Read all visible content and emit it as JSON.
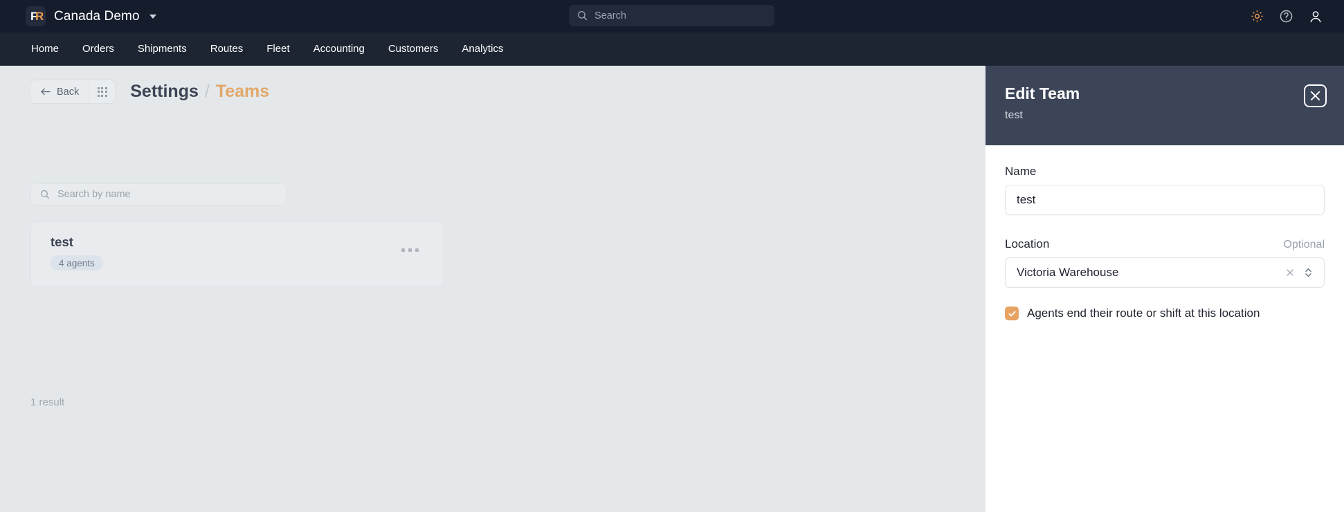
{
  "topbar": {
    "logo_letter_f": "F",
    "logo_letter_r": "R",
    "org_name": "Canada Demo",
    "search_placeholder": "Search",
    "icons": [
      "gear-icon",
      "help-icon",
      "account-icon"
    ],
    "bg_color": "#151c2c",
    "accent_color": "#e89a4f"
  },
  "nav": {
    "items": [
      {
        "label": "Home"
      },
      {
        "label": "Orders"
      },
      {
        "label": "Shipments"
      },
      {
        "label": "Routes"
      },
      {
        "label": "Fleet"
      },
      {
        "label": "Accounting"
      },
      {
        "label": "Customers"
      },
      {
        "label": "Analytics"
      }
    ],
    "bg_color": "#1d2533"
  },
  "toolbar": {
    "back_label": "Back",
    "grid_icon": "apps-grid-icon"
  },
  "breadcrumb": {
    "parent": "Settings",
    "separator": "/",
    "current": "Teams",
    "current_color": "#e2a869"
  },
  "list": {
    "search_placeholder": "Search by name",
    "cards": [
      {
        "name": "test",
        "badge": "4 agents",
        "menu_icon": "ellipsis-icon"
      }
    ],
    "result_count": "1 result"
  },
  "panel": {
    "title": "Edit Team",
    "subtitle": "test",
    "close_icon": "close-icon",
    "header_bg": "#3c4558",
    "name_field": {
      "label": "Name",
      "value": "test"
    },
    "location_field": {
      "label": "Location",
      "optional": "Optional",
      "value": "Victoria Warehouse",
      "clear_icon": "clear-x-icon",
      "chevron_icon": "chevron-updown-icon"
    },
    "checkbox": {
      "label": "Agents end their route or shift at this location",
      "checked": true,
      "color": "#e8a261"
    }
  }
}
